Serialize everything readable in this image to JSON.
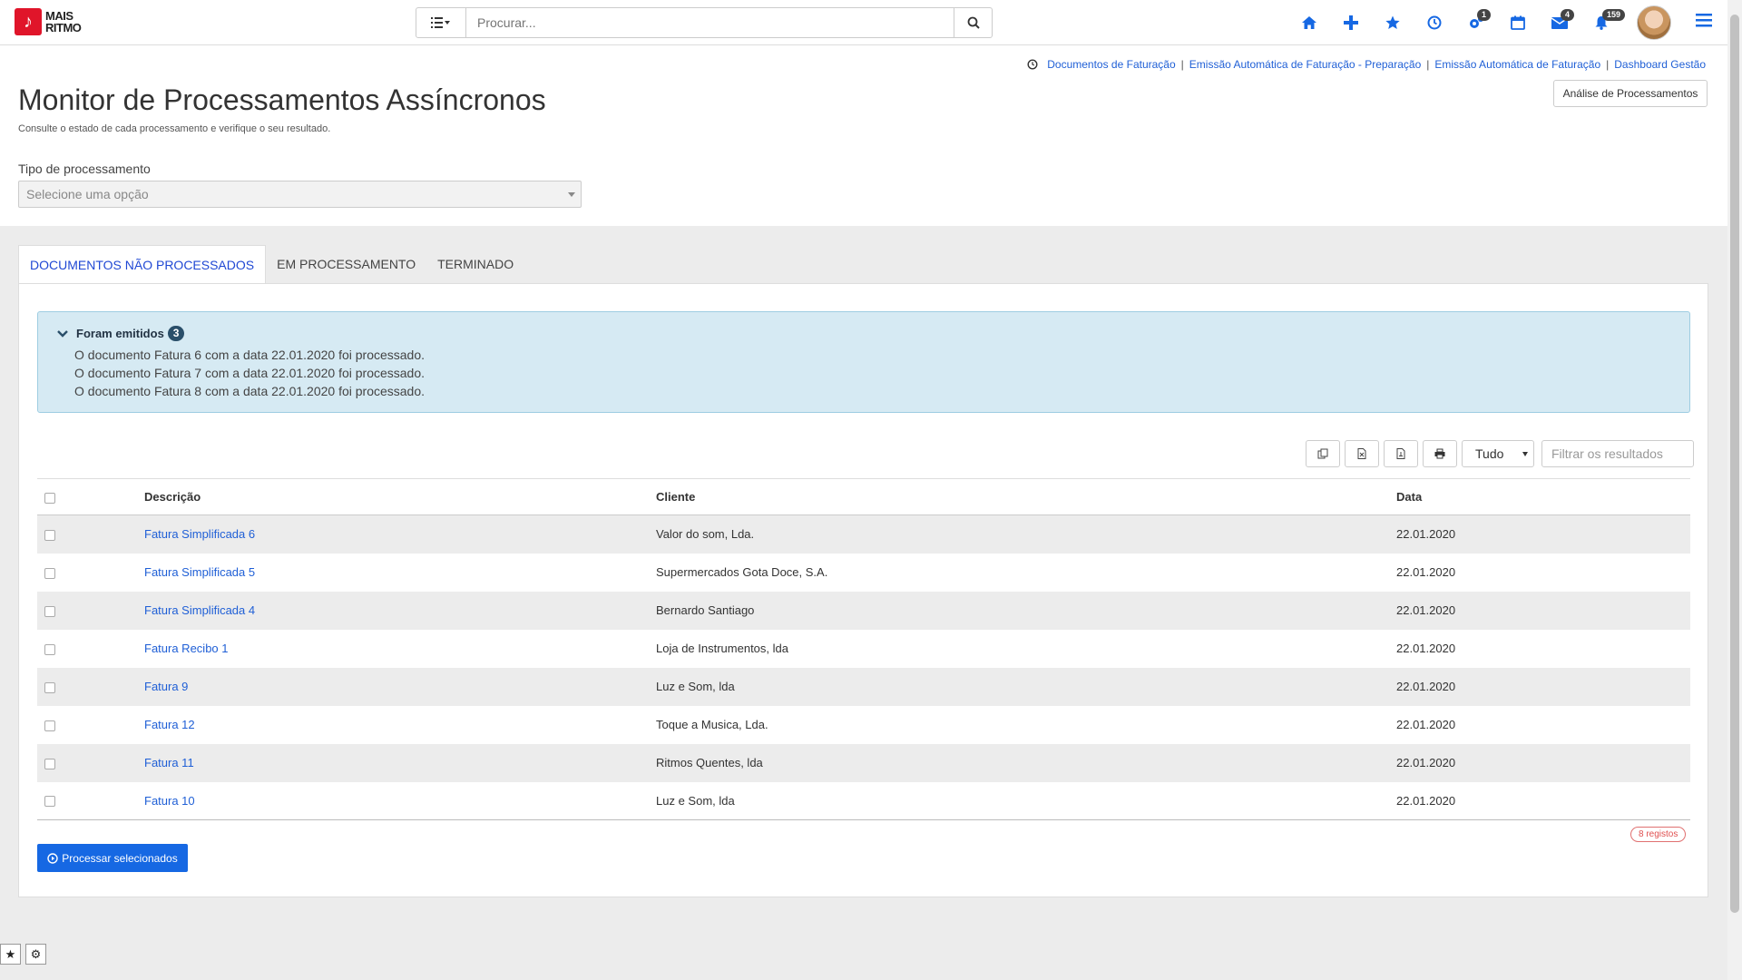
{
  "app": {
    "logo_line1": "MAIS",
    "logo_line2": "RITMO"
  },
  "search": {
    "placeholder": "Procurar..."
  },
  "nav": {
    "badges": {
      "tasks": "1",
      "messages": "4",
      "notifications": "159"
    }
  },
  "breadcrumbs": [
    "Documentos de Faturação",
    "Emissão Automática de Faturação - Preparação",
    "Emissão Automática de Faturação",
    "Dashboard Gestão"
  ],
  "header": {
    "title": "Monitor de Processamentos Assíncronos",
    "subtitle": "Consulte o estado de cada processamento e verifique o seu resultado.",
    "analysis_button": "Análise de Processamentos",
    "type_label": "Tipo de processamento",
    "type_placeholder": "Selecione uma opção"
  },
  "tabs": [
    {
      "label": "DOCUMENTOS NÃO PROCESSADOS",
      "active": true
    },
    {
      "label": "EM PROCESSAMENTO",
      "active": false
    },
    {
      "label": "TERMINADO",
      "active": false
    }
  ],
  "alert": {
    "title": "Foram emitidos",
    "count": "3",
    "lines": [
      "O documento Fatura 6 com a data 22.01.2020 foi processado.",
      "O documento Fatura 7 com a data 22.01.2020 foi processado.",
      "O documento Fatura 8 com a data 22.01.2020 foi processado."
    ]
  },
  "tools": {
    "select_value": "Tudo",
    "filter_placeholder": "Filtrar os resultados"
  },
  "table": {
    "headers": [
      "Descrição",
      "Cliente",
      "Data"
    ],
    "rows": [
      {
        "desc": "Fatura Simplificada 6",
        "client": "Valor do som, Lda.",
        "date": "22.01.2020"
      },
      {
        "desc": "Fatura Simplificada 5",
        "client": "Supermercados Gota Doce, S.A.",
        "date": "22.01.2020"
      },
      {
        "desc": "Fatura Simplificada 4",
        "client": "Bernardo Santiago",
        "date": "22.01.2020"
      },
      {
        "desc": "Fatura Recibo 1",
        "client": "Loja de Instrumentos, lda",
        "date": "22.01.2020"
      },
      {
        "desc": "Fatura 9",
        "client": "Luz e Som, lda",
        "date": "22.01.2020"
      },
      {
        "desc": "Fatura 12",
        "client": "Toque a Musica, Lda.",
        "date": "22.01.2020"
      },
      {
        "desc": "Fatura 11",
        "client": "Ritmos Quentes, lda",
        "date": "22.01.2020"
      },
      {
        "desc": "Fatura 10",
        "client": "Luz e Som, lda",
        "date": "22.01.2020"
      }
    ]
  },
  "footer": {
    "records": "8 registos",
    "process_button": "Processar selecionados"
  },
  "colors": {
    "accent": "#1668e3",
    "brand": "#e0152a",
    "alert_bg": "#d6eaf3"
  }
}
